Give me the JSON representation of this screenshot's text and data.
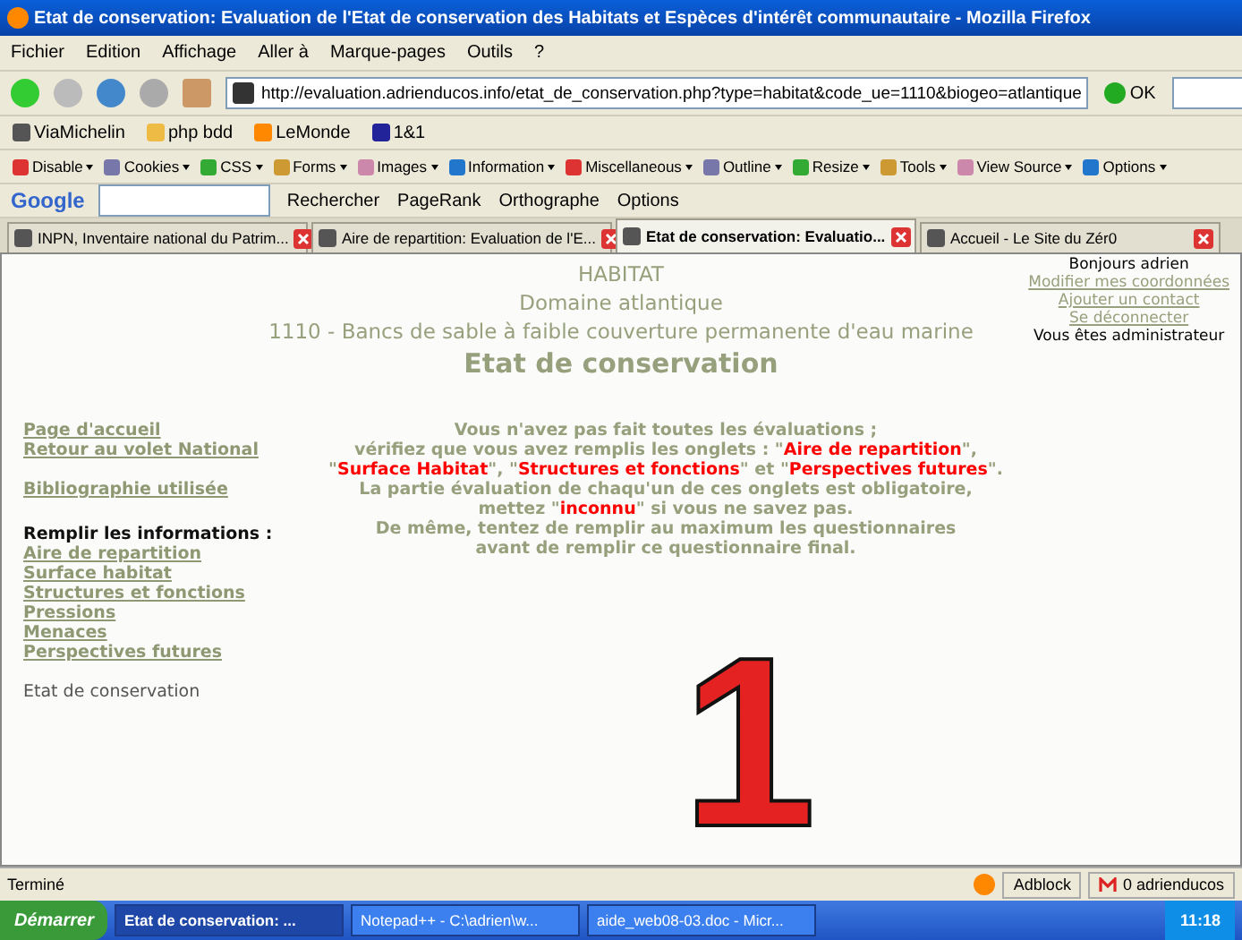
{
  "window": {
    "title": "Etat de conservation: Evaluation de l'Etat de conservation des Habitats et Espèces d'intérêt communautaire - Mozilla Firefox"
  },
  "menu": [
    "Fichier",
    "Edition",
    "Affichage",
    "Aller à",
    "Marque-pages",
    "Outils",
    "?"
  ],
  "address": {
    "value": "http://evaluation.adrienducos.info/etat_de_conservation.php?type=habitat&code_ue=1110&biogeo=atlantique",
    "go": "OK"
  },
  "bookmarks": [
    "ViaMichelin",
    "php bdd",
    "LeMonde",
    "1&1"
  ],
  "webdev_toolbar": [
    "Disable",
    "Cookies",
    "CSS",
    "Forms",
    "Images",
    "Information",
    "Miscellaneous",
    "Outline",
    "Resize",
    "Tools",
    "View Source",
    "Options"
  ],
  "google_toolbar": {
    "logo": "Google",
    "items": [
      "Rechercher",
      "PageRank",
      "Orthographe",
      "Options"
    ]
  },
  "tabs": [
    {
      "label": "INPN, Inventaire national du Patrim...",
      "selected": false
    },
    {
      "label": "Aire de repartition: Evaluation de l'E...",
      "selected": false
    },
    {
      "label": "Etat de conservation: Evaluatio...",
      "selected": true
    },
    {
      "label": "Accueil - Le Site du Zér0",
      "selected": false
    }
  ],
  "page": {
    "heading": [
      "HABITAT",
      "Domaine atlantique",
      "1110 - Bancs de sable à faible couverture permanente d'eau marine"
    ],
    "title": "Etat de conservation",
    "user": [
      {
        "kind": "text",
        "text": "Bonjours adrien"
      },
      {
        "kind": "link",
        "text": "Modifier mes coordonnées"
      },
      {
        "kind": "link",
        "text": "Ajouter un contact"
      },
      {
        "kind": "link",
        "text": "Se déconnecter"
      },
      {
        "kind": "text",
        "text": "Vous êtes administrateur"
      }
    ],
    "nav": [
      {
        "kind": "link",
        "text": "Page d'accueil"
      },
      {
        "kind": "link",
        "text": "Retour au volet National"
      },
      {
        "kind": "gap"
      },
      {
        "kind": "link",
        "text": "Bibliographie utilisée"
      },
      {
        "kind": "gap"
      },
      {
        "kind": "heading",
        "text": "Remplir les informations :"
      },
      {
        "kind": "link",
        "text": "Aire de repartition"
      },
      {
        "kind": "link",
        "text": "Surface habitat"
      },
      {
        "kind": "link",
        "text": "Structures et fonctions"
      },
      {
        "kind": "link",
        "text": "Pressions"
      },
      {
        "kind": "link",
        "text": "Menaces"
      },
      {
        "kind": "link",
        "text": "Perspectives futures"
      },
      {
        "kind": "gap"
      },
      {
        "kind": "current",
        "text": "Etat de conservation"
      }
    ],
    "message": [
      [
        {
          "kind": "plain",
          "text": "Vous n'avez pas fait toutes les évaluations ;"
        }
      ],
      [
        {
          "kind": "plain",
          "text": "vérifiez que vous avez remplis les onglets : \""
        },
        {
          "kind": "red",
          "text": "Aire de repartition"
        },
        {
          "kind": "plain",
          "text": "\","
        }
      ],
      [
        {
          "kind": "plain",
          "text": "\""
        },
        {
          "kind": "red",
          "text": "Surface Habitat"
        },
        {
          "kind": "plain",
          "text": "\", \""
        },
        {
          "kind": "red",
          "text": "Structures et fonctions"
        },
        {
          "kind": "plain",
          "text": "\" et \""
        },
        {
          "kind": "red",
          "text": "Perspectives futures"
        },
        {
          "kind": "plain",
          "text": "\"."
        }
      ],
      [
        {
          "kind": "plain",
          "text": "La partie évaluation de chaqu'un de ces onglets est obligatoire,"
        }
      ],
      [
        {
          "kind": "plain",
          "text": "mettez \""
        },
        {
          "kind": "red",
          "text": "inconnu"
        },
        {
          "kind": "plain",
          "text": "\" si vous ne savez pas."
        }
      ],
      [
        {
          "kind": "plain",
          "text": "De même, tentez de remplir au maximum les questionnaires"
        }
      ],
      [
        {
          "kind": "plain",
          "text": "avant de remplir ce questionnaire final."
        }
      ]
    ],
    "annotation": "1"
  },
  "status_bar": {
    "text": "Terminé",
    "adblock": "Adblock",
    "mail": "0 adrienducos"
  },
  "taskbar": {
    "start": "Démarrer",
    "tasks": [
      {
        "label": "Etat de conservation: ...",
        "selected": true
      },
      {
        "label": "Notepad++ - C:\\adrien\\w...",
        "selected": false
      },
      {
        "label": "aide_web08-03.doc - Micr...",
        "selected": false
      }
    ],
    "clock": "11:18"
  }
}
